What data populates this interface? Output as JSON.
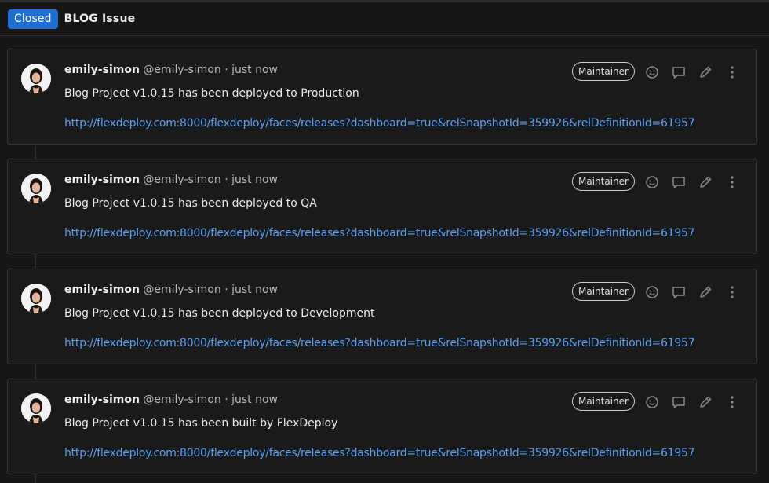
{
  "header": {
    "status": "Closed",
    "title": "BLOG Issue"
  },
  "notes": [
    {
      "author": "emily-simon",
      "handle": "@emily-simon",
      "time": "· just now",
      "role": "Maintainer",
      "message": "Blog Project v1.0.15 has been deployed to Production",
      "link": "http://flexdeploy.com:8000/flexdeploy/faces/releases?dashboard=true&relSnapshotId=359926&relDefinitionId=61957"
    },
    {
      "author": "emily-simon",
      "handle": "@emily-simon",
      "time": "· just now",
      "role": "Maintainer",
      "message": "Blog Project v1.0.15 has been deployed to QA",
      "link": "http://flexdeploy.com:8000/flexdeploy/faces/releases?dashboard=true&relSnapshotId=359926&relDefinitionId=61957"
    },
    {
      "author": "emily-simon",
      "handle": "@emily-simon",
      "time": "· just now",
      "role": "Maintainer",
      "message": "Blog Project v1.0.15 has been deployed to Development",
      "link": "http://flexdeploy.com:8000/flexdeploy/faces/releases?dashboard=true&relSnapshotId=359926&relDefinitionId=61957"
    },
    {
      "author": "emily-simon",
      "handle": "@emily-simon",
      "time": "· just now",
      "role": "Maintainer",
      "message": "Blog Project v1.0.15 has been built by FlexDeploy",
      "link": "http://flexdeploy.com:8000/flexdeploy/faces/releases?dashboard=true&relSnapshotId=359926&relDefinitionId=61957"
    }
  ],
  "icons": {
    "avatar": "avatar-photo",
    "react": "smiley-icon",
    "reply": "comment-icon",
    "edit": "pencil-icon",
    "more": "kebab-menu-icon"
  },
  "colors": {
    "status_badge": "#1f6fd1",
    "link": "#5b9ef0",
    "background": "#161616"
  }
}
